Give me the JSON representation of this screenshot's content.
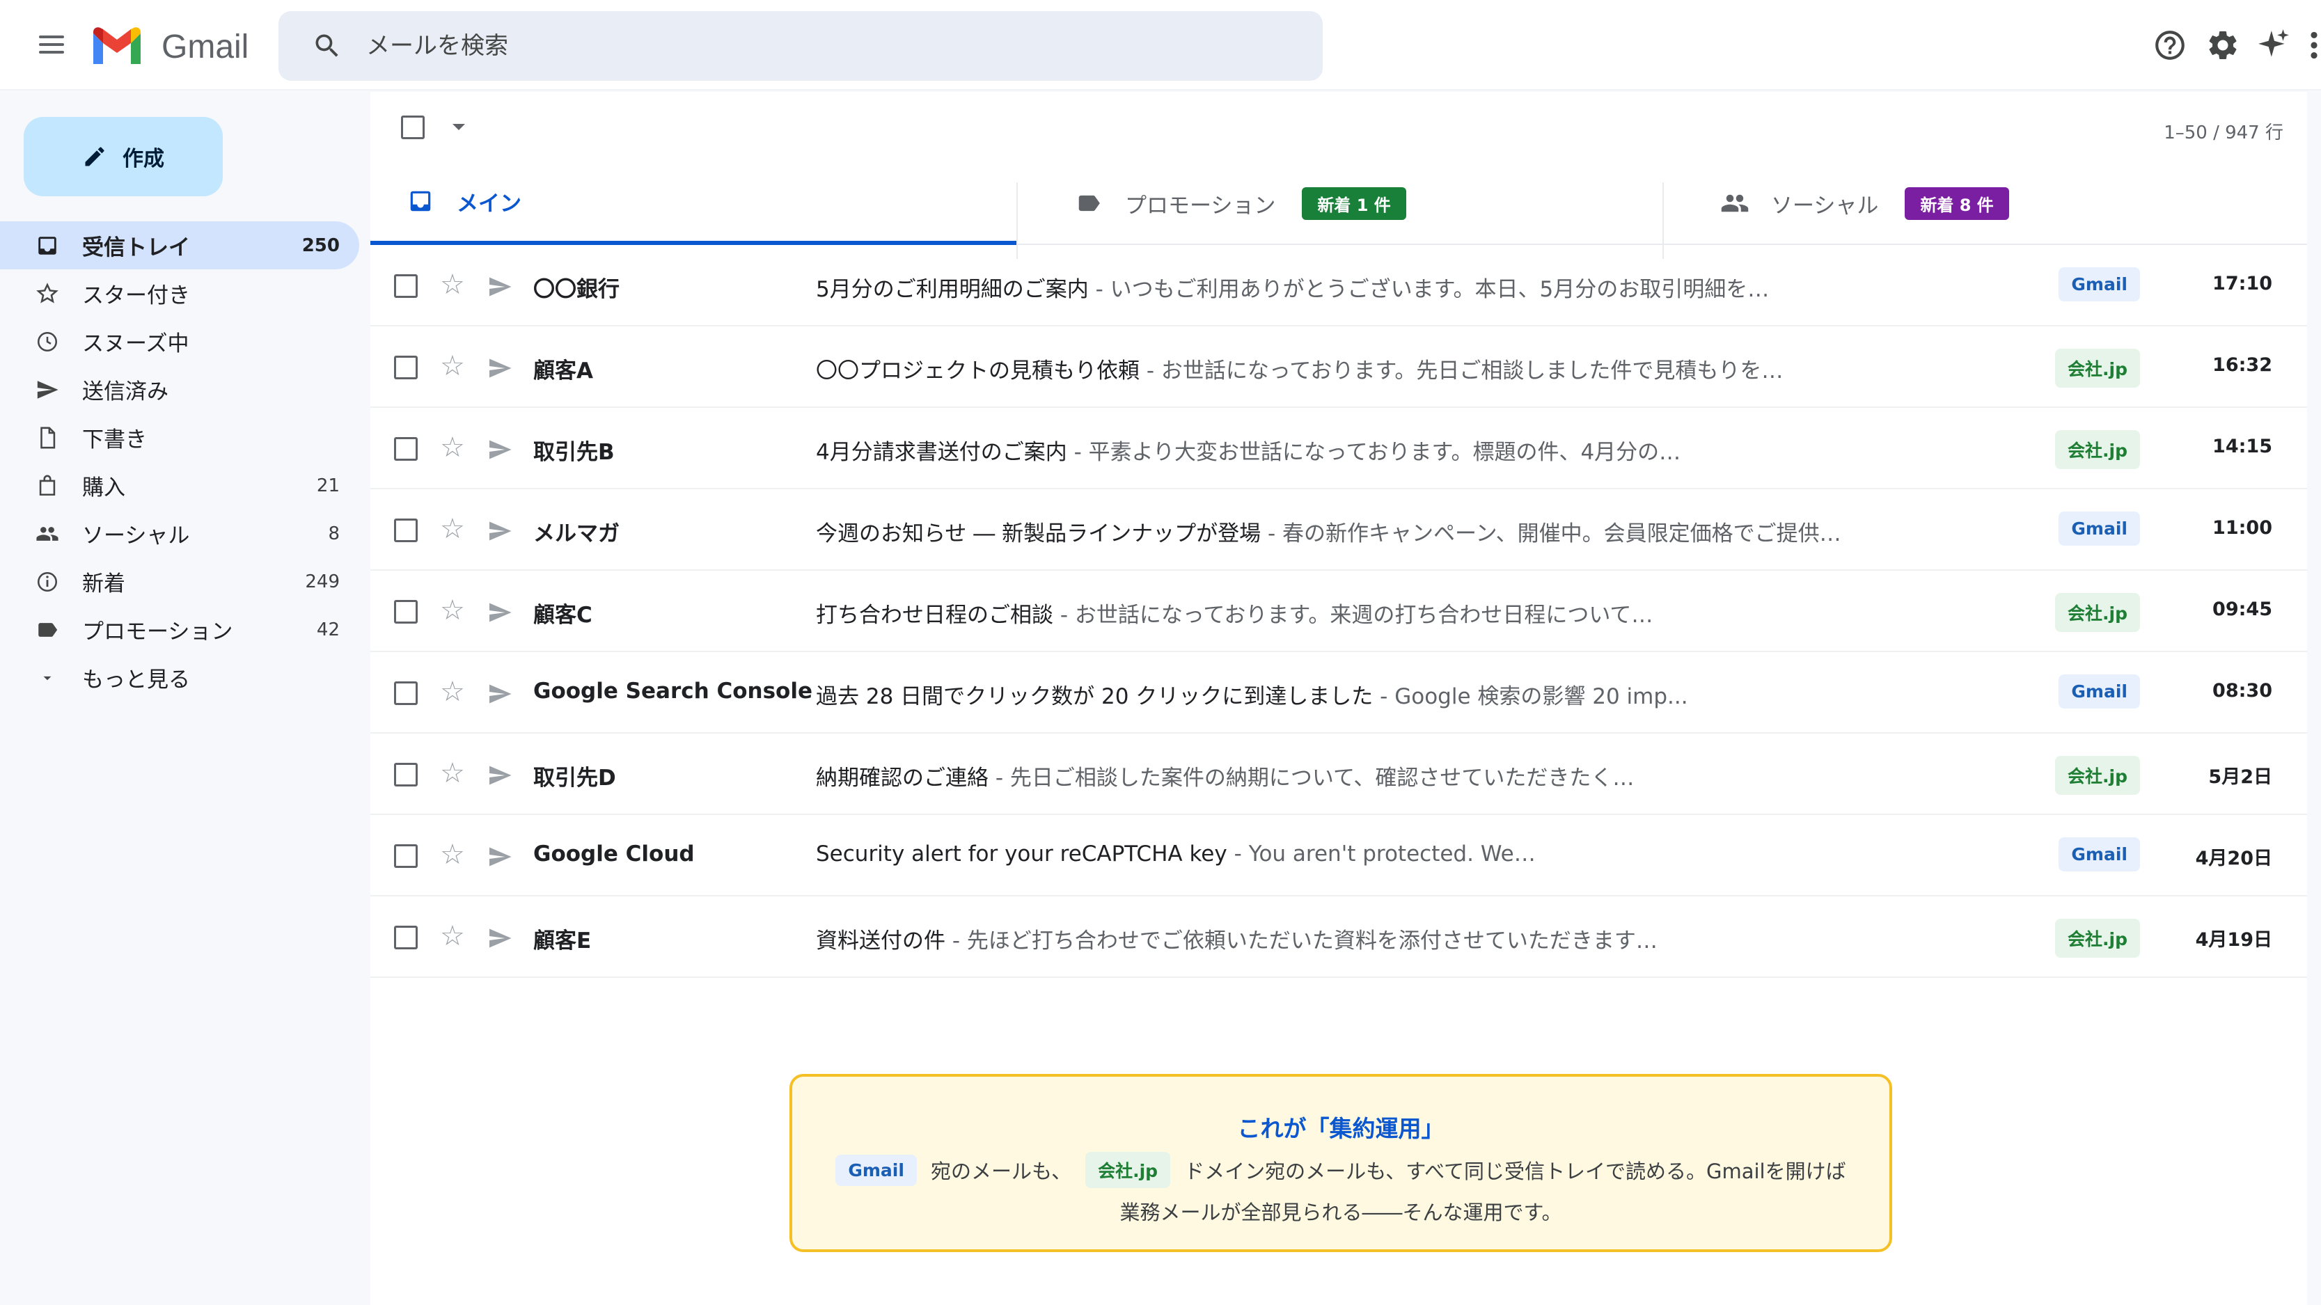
{
  "header": {
    "brand": "Gmail",
    "search_placeholder": "メールを検索"
  },
  "compose": {
    "label": "作成"
  },
  "sidebar": {
    "items": [
      {
        "label": "受信トレイ",
        "count": "250",
        "icon": "inbox-icon",
        "active": true
      },
      {
        "label": "スター付き",
        "count": "",
        "icon": "star-icon"
      },
      {
        "label": "スヌーズ中",
        "count": "",
        "icon": "clock-icon"
      },
      {
        "label": "送信済み",
        "count": "",
        "icon": "send-icon"
      },
      {
        "label": "下書き",
        "count": "",
        "icon": "draft-icon"
      },
      {
        "label": "購入",
        "count": "21",
        "icon": "shopping-bag-icon"
      },
      {
        "label": "ソーシャル",
        "count": "8",
        "icon": "people-icon"
      },
      {
        "label": "新着",
        "count": "249",
        "icon": "info-icon"
      },
      {
        "label": "プロモーション",
        "count": "42",
        "icon": "label-icon"
      },
      {
        "label": "もっと見る",
        "count": "",
        "icon": "chevron-down-icon"
      }
    ]
  },
  "toolbar": {
    "pager": "1–50 / 947 行"
  },
  "tabs": [
    {
      "label": "メイン",
      "badge": ""
    },
    {
      "label": "プロモーション",
      "badge": "新着 1 件",
      "badge_color": "#188038"
    },
    {
      "label": "ソーシャル",
      "badge": "新着 8 件",
      "badge_color": "#7b1fa2"
    }
  ],
  "emails": [
    {
      "sender": "〇〇銀行",
      "subject": "5月分のご利用明細のご案内",
      "snippet": "いつもご利用ありがとうございます。本日、5月分のお取引明細を…",
      "label": "Gmail",
      "label_type": "gmail",
      "time": "17:10"
    },
    {
      "sender": "顧客A",
      "subject": "〇〇プロジェクトの見積もり依頼",
      "snippet": "お世話になっております。先日ご相談しました件で見積もりを…",
      "label": "会社.jp",
      "label_type": "company",
      "time": "16:32"
    },
    {
      "sender": "取引先B",
      "subject": "4月分請求書送付のご案内",
      "snippet": "平素より大変お世話になっております。標題の件、4月分の…",
      "label": "会社.jp",
      "label_type": "company",
      "time": "14:15"
    },
    {
      "sender": "メルマガ",
      "subject": "今週のお知らせ ― 新製品ラインナップが登場",
      "snippet": "春の新作キャンペーン、開催中。会員限定価格でご提供…",
      "label": "Gmail",
      "label_type": "gmail",
      "time": "11:00"
    },
    {
      "sender": "顧客C",
      "subject": "打ち合わせ日程のご相談",
      "snippet": "お世話になっております。来週の打ち合わせ日程について…",
      "label": "会社.jp",
      "label_type": "company",
      "time": "09:45"
    },
    {
      "sender": "Google Search Console",
      "subject": "過去 28 日間でクリック数が 20 クリックに到達しました",
      "snippet": "Google 検索の影響 20 imp...",
      "label": "Gmail",
      "label_type": "gmail",
      "time": "08:30"
    },
    {
      "sender": "取引先D",
      "subject": "納期確認のご連絡",
      "snippet": "先日ご相談した案件の納期について、確認させていただきたく…",
      "label": "会社.jp",
      "label_type": "company",
      "time": "5月2日"
    },
    {
      "sender": "Google Cloud",
      "subject": "Security alert for your reCAPTCHA key",
      "snippet": "You aren't protected. We…",
      "label": "Gmail",
      "label_type": "gmail",
      "time": "4月20日"
    },
    {
      "sender": "顧客E",
      "subject": "資料送付の件",
      "snippet": "先ほど打ち合わせでご依頼いただいた資料を添付させていただきます…",
      "label": "会社.jp",
      "label_type": "company",
      "time": "4月19日"
    }
  ],
  "callout": {
    "title": "これが「集約運用」",
    "pill_gmail": "Gmail",
    "text_a": "宛のメールも、",
    "pill_company": "会社.jp",
    "text_b": "ドメイン宛のメールも、すべて同じ受信トレイで読める。Gmailを開けば",
    "line2": "業務メールが全部見られる――そんな運用です。"
  },
  "colors": {
    "accent": "#0b57d0",
    "compose_bg": "#c2e7ff",
    "active_nav": "#d3e3fd",
    "callout_border": "#f5c026"
  }
}
